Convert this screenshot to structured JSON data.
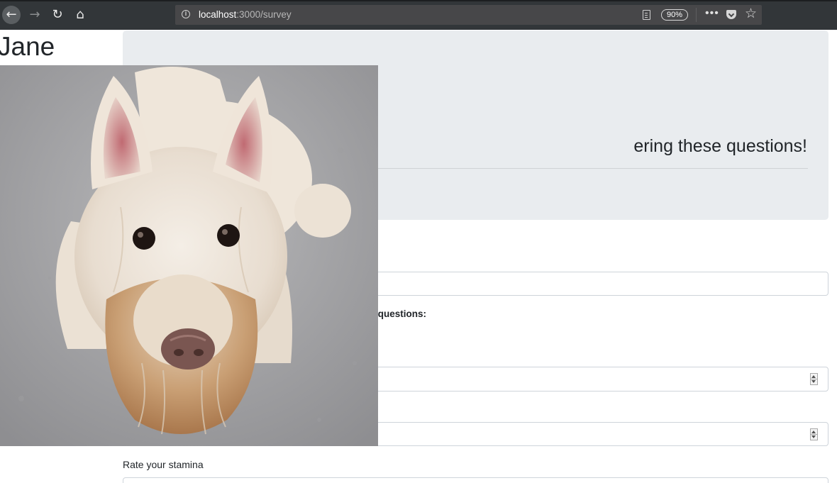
{
  "browser": {
    "url_host": "localhost",
    "url_rest": ":3000/survey",
    "zoom": "90%",
    "icons": {
      "back": "back-arrow-icon",
      "forward": "forward-arrow-icon",
      "reload": "reload-icon",
      "home": "home-icon",
      "info": "info-icon",
      "reader": "reader-view-icon",
      "more": "more-dots-icon",
      "pocket": "pocket-icon",
      "bookmark": "star-icon"
    }
  },
  "page": {
    "user_name": "Jane",
    "jumbotron_text": "ering these questions!",
    "questions_heading": "questions:",
    "stamina_label": "Rate your stamina"
  },
  "photo": {
    "subject": "white terrier dog"
  },
  "colors": {
    "toolbar": "#323639",
    "urlbar": "#474749",
    "jumbotron": "#e9ecef",
    "field_border": "#ced4da"
  }
}
